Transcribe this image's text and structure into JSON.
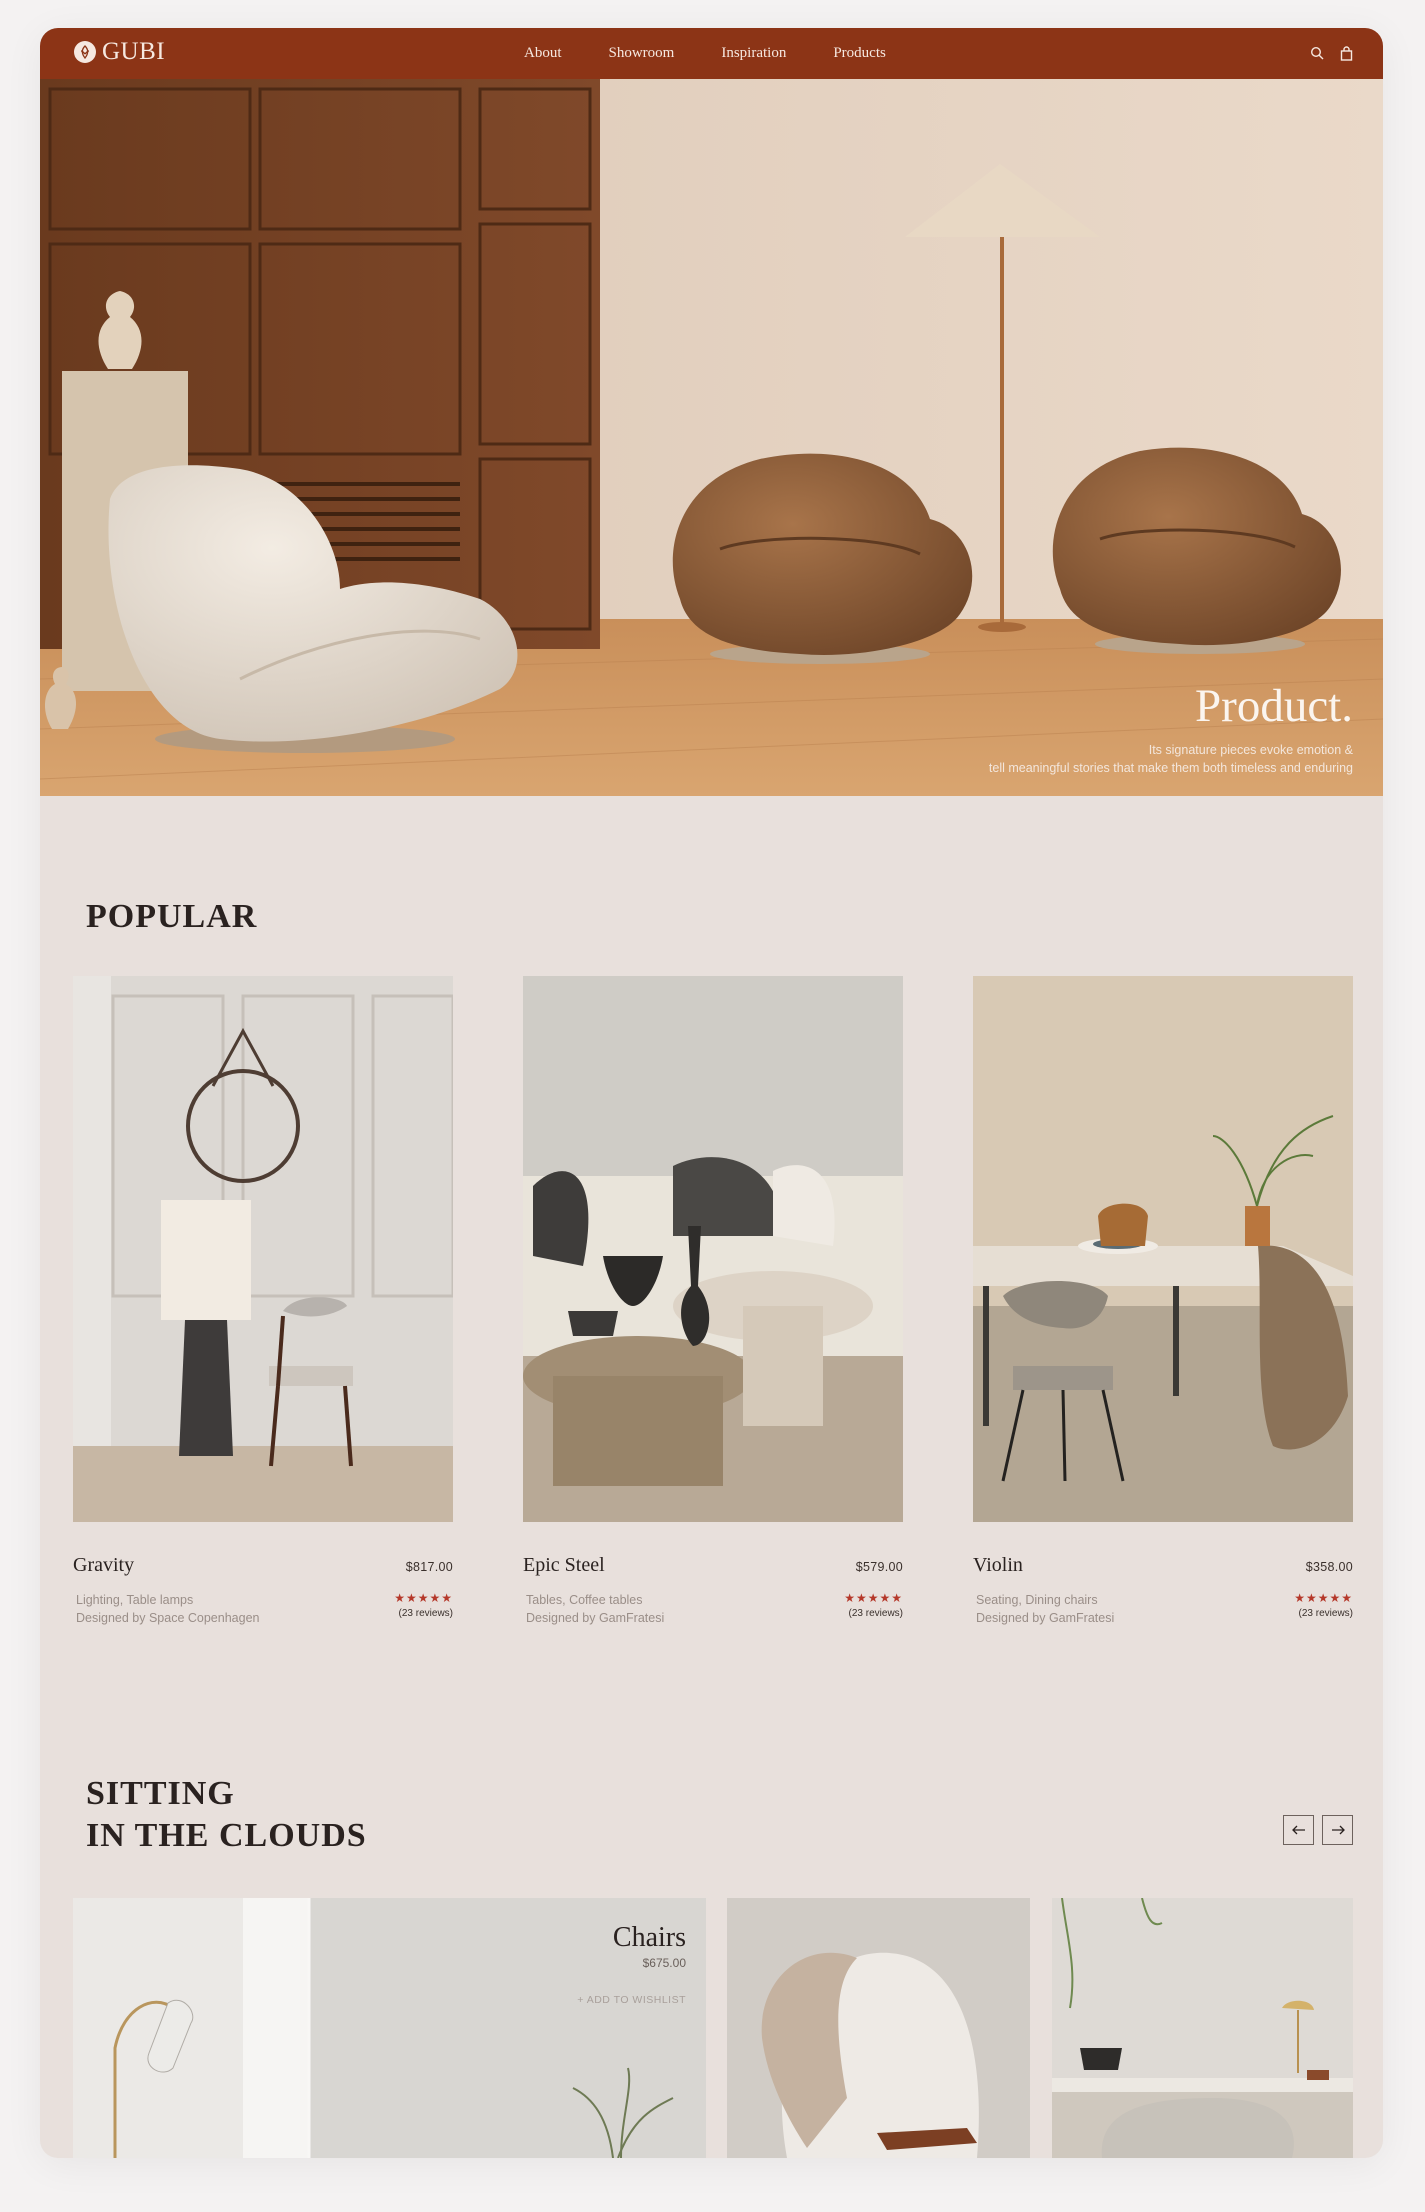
{
  "brand": {
    "name": "GUBI"
  },
  "nav": {
    "items": [
      "About",
      "Showroom",
      "Inspiration",
      "Products"
    ],
    "icons": [
      "search-icon",
      "bag-icon"
    ]
  },
  "hero": {
    "title": "Product.",
    "subtitle_line1": "Its signature pieces evoke emotion &",
    "subtitle_line2": "tell meaningful stories that make them both timeless and enduring"
  },
  "popular": {
    "heading": "POPULAR",
    "products": [
      {
        "name": "Gravity",
        "price": "$817.00",
        "category": "Lighting, Table lamps",
        "designer": "Designed by Space Copenhagen",
        "stars": "★★★★★",
        "rating": 5,
        "reviews": "(23 reviews)"
      },
      {
        "name": "Epic Steel",
        "price": "$579.00",
        "category": "Tables, Coffee tables",
        "designer": "Designed by GamFratesi",
        "stars": "★★★★★",
        "rating": 5,
        "reviews": "(23 reviews)"
      },
      {
        "name": "Violin",
        "price": "$358.00",
        "category": "Seating, Dining chairs",
        "designer": "Designed by GamFratesi",
        "stars": "★★★★★",
        "rating": 5,
        "reviews": "(23 reviews)"
      }
    ]
  },
  "clouds": {
    "heading_line1": "SITTING",
    "heading_line2": "IN THE CLOUDS",
    "prev_icon": "arrow-left-icon",
    "next_icon": "arrow-right-icon",
    "featured": {
      "name": "Chairs",
      "price": "$675.00",
      "wishlist": "+ ADD TO WISHLIST"
    }
  },
  "colors": {
    "brand": "#8c3416",
    "background": "#e8e0dc",
    "star": "#b5382a"
  }
}
